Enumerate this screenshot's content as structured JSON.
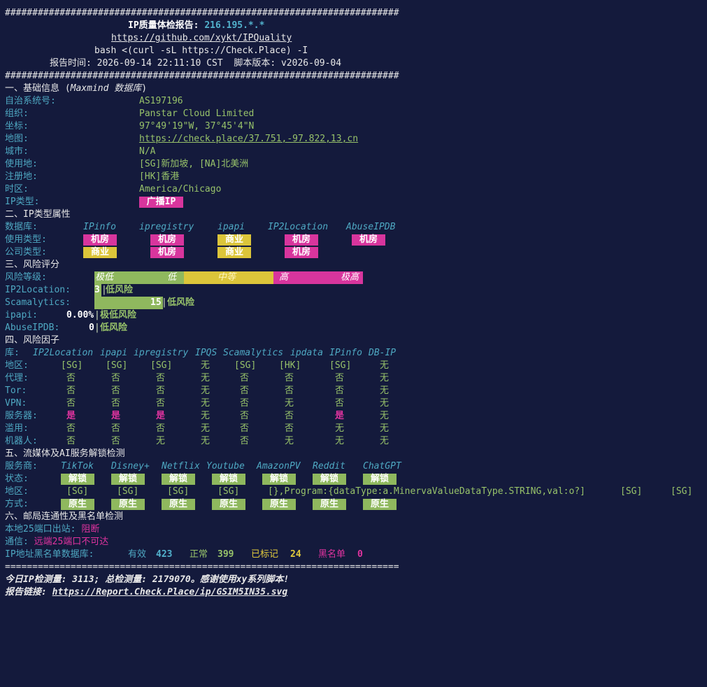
{
  "header": {
    "hash_line": "########################################################################",
    "title_label": "IP质量体检报告: ",
    "title_ip": "216.195.*.*",
    "repo_url": "https://github.com/xykt/IPQuality",
    "command": "bash <(curl -sL https://Check.Place) -I",
    "report_time_label": "报告时间: ",
    "report_time": "2026-09-14 22:11:10 CST",
    "script_version_label": "脚本版本: ",
    "script_version": "v2026-09-04"
  },
  "basic": {
    "heading": "一、基础信息 (",
    "heading_db": "Maxmind 数据库",
    "heading_close": ")",
    "rows": [
      {
        "label": "自治系统号:",
        "value": "AS197196"
      },
      {
        "label": "组织:",
        "value": "Panstar Cloud Limited"
      },
      {
        "label": "坐标:",
        "value": "97°49'19\"W, 37°45'4\"N"
      },
      {
        "label": "地图:",
        "value": "https://check.place/37.751,-97.822,13,cn"
      },
      {
        "label": "城市:",
        "value": "N/A"
      },
      {
        "label": "使用地:",
        "value": "[SG]新加坡, [NA]北美洲"
      },
      {
        "label": "注册地:",
        "value": "[HK]香港"
      },
      {
        "label": "时区:",
        "value": "America/Chicago"
      }
    ],
    "ip_type_label": "IP类型:",
    "ip_type_value": "广播IP"
  },
  "iptype": {
    "heading": "二、IP类型属性",
    "db_label": "数据库:",
    "dbs": [
      "IPinfo",
      "ipregistry",
      "ipapi",
      "IP2Location",
      "AbuseIPDB"
    ],
    "usage_label": "使用类型:",
    "usage": [
      "机房",
      "机房",
      "商业",
      "机房",
      "机房"
    ],
    "company_label": "公司类型:",
    "company": [
      "商业",
      "机房",
      "商业",
      "机房"
    ]
  },
  "risk": {
    "heading": "三、风险评分",
    "level_label": "风险等级:",
    "scale": [
      "极低",
      "低",
      "中等",
      "高",
      "极高"
    ],
    "rows": [
      {
        "label": "IP2Location:",
        "score": "3",
        "desc": "低风险"
      },
      {
        "label": "Scamalytics:",
        "score": "15",
        "desc": "低风险"
      },
      {
        "label": "ipapi:",
        "score": "0.00%",
        "desc": "极低风险"
      },
      {
        "label": "AbuseIPDB:",
        "score": "0",
        "desc": "低风险"
      }
    ]
  },
  "factors": {
    "heading": "四、风险因子",
    "lib_label": "库:",
    "columns": [
      "IP2Location",
      "ipapi",
      "ipregistry",
      "IPQS",
      "Scamalytics",
      "ipdata",
      "IPinfo",
      "DB-IP"
    ],
    "rows": [
      {
        "label": "地区:",
        "values": [
          "[SG]",
          "[SG]",
          "[SG]",
          "无",
          "[SG]",
          "[HK]",
          "[SG]",
          "无"
        ]
      },
      {
        "label": "代理:",
        "values": [
          "否",
          "否",
          "否",
          "无",
          "否",
          "否",
          "否",
          "无"
        ]
      },
      {
        "label": "Tor:",
        "values": [
          "否",
          "否",
          "否",
          "无",
          "否",
          "否",
          "否",
          "无"
        ]
      },
      {
        "label": "VPN:",
        "values": [
          "否",
          "否",
          "否",
          "无",
          "否",
          "无",
          "否",
          "无"
        ]
      },
      {
        "label": "服务器:",
        "values": [
          "是",
          "是",
          "是",
          "无",
          "否",
          "否",
          "是",
          "无"
        ]
      },
      {
        "label": "滥用:",
        "values": [
          "否",
          "否",
          "否",
          "无",
          "否",
          "否",
          "无",
          "无"
        ]
      },
      {
        "label": "机器人:",
        "values": [
          "否",
          "否",
          "无",
          "无",
          "否",
          "无",
          "无",
          "无"
        ]
      }
    ]
  },
  "streaming": {
    "heading": "五、流媒体及AI服务解锁检测",
    "provider_label": "服务商:",
    "providers": [
      "TikTok",
      "Disney+",
      "Netflix",
      "Youtube",
      "AmazonPV",
      "Reddit",
      "ChatGPT"
    ],
    "status_label": "状态:",
    "status": [
      "解锁",
      "解锁",
      "解锁",
      "解锁",
      "解锁",
      "解锁",
      "解锁"
    ],
    "region_label": "地区:",
    "regions": [
      "[SG]",
      "[SG]",
      "[SG]",
      "[SG]",
      "[},Program:{dataType:a.MinervaValueDataType.STRING,val:o?]",
      "[SG]",
      "[SG]"
    ],
    "method_label": "方式:",
    "methods": [
      "原生",
      "原生",
      "原生",
      "原生",
      "原生",
      "原生",
      "原生"
    ]
  },
  "mail": {
    "heading": "六、邮局连通性及黑名单检测",
    "port_label": "本地25端口出站: ",
    "port_value": "阻断",
    "conn_label": "通信: ",
    "conn_value": "远端25端口不可达",
    "bl_label": "IP地址黑名单数据库:",
    "valid_label": "有效",
    "valid": "423",
    "normal_label": "正常",
    "normal": "399",
    "marked_label": "已标记",
    "marked": "24",
    "black_label": "黑名单",
    "black": "0"
  },
  "footer": {
    "eq_line": "========================================================================",
    "stats": "今日IP检测量: 3113; 总检测量: 2179070。感谢使用xy系列脚本!",
    "link_label": "报告链接: ",
    "link": "https://Report.Check.Place/ip/GSIM5IN35.svg"
  },
  "colors": {
    "background": "#141a3c",
    "magenta": "#d8359d",
    "yellow": "#dcc53a",
    "green": "#8fb85e",
    "cyan": "#4ea8c2"
  }
}
